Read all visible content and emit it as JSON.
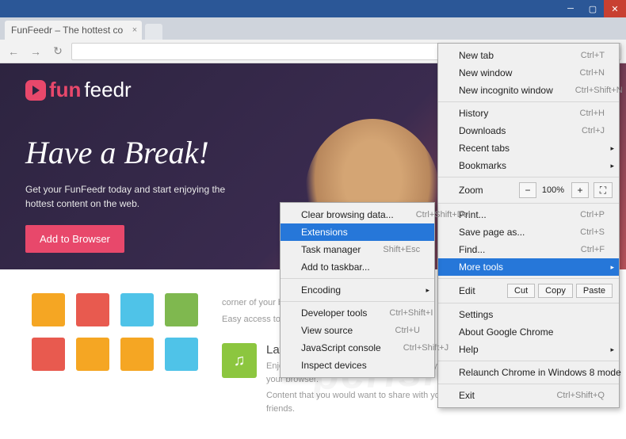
{
  "window": {
    "tab_title": "FunFeedr – The hottest co"
  },
  "site": {
    "logo_prefix": "fun",
    "logo_suffix": "feedr",
    "headline": "Have a Break!",
    "sub": "Get your FunFeedr today and start enjoying the hottest content on the web.",
    "cta": "Add to Browser",
    "card1_title": "",
    "card1_p1": "corner of your browser.",
    "card1_p2": "Easy access to the fun.",
    "card2_title": "Latest Content",
    "card2_p1": "Enjoy the hottest content on the web directly from your browser.",
    "card2_p2": "Content that you would want to share with your friends."
  },
  "menu": {
    "new_tab": "New tab",
    "new_tab_sc": "Ctrl+T",
    "new_window": "New window",
    "new_window_sc": "Ctrl+N",
    "incognito": "New incognito window",
    "incognito_sc": "Ctrl+Shift+N",
    "history": "History",
    "history_sc": "Ctrl+H",
    "downloads": "Downloads",
    "downloads_sc": "Ctrl+J",
    "recent": "Recent tabs",
    "bookmarks": "Bookmarks",
    "zoom": "Zoom",
    "zoom_val": "100%",
    "print": "Print...",
    "print_sc": "Ctrl+P",
    "save": "Save page as...",
    "save_sc": "Ctrl+S",
    "find": "Find...",
    "find_sc": "Ctrl+F",
    "more_tools": "More tools",
    "edit": "Edit",
    "cut": "Cut",
    "copy": "Copy",
    "paste": "Paste",
    "settings": "Settings",
    "about": "About Google Chrome",
    "help": "Help",
    "relaunch": "Relaunch Chrome in Windows 8 mode",
    "exit": "Exit",
    "exit_sc": "Ctrl+Shift+Q"
  },
  "submenu": {
    "clear": "Clear browsing data...",
    "clear_sc": "Ctrl+Shift+Del",
    "extensions": "Extensions",
    "task": "Task manager",
    "task_sc": "Shift+Esc",
    "taskbar": "Add to taskbar...",
    "encoding": "Encoding",
    "devtools": "Developer tools",
    "devtools_sc": "Ctrl+Shift+I",
    "source": "View source",
    "source_sc": "Ctrl+U",
    "console": "JavaScript console",
    "console_sc": "Ctrl+Shift+J",
    "inspect": "Inspect devices"
  }
}
